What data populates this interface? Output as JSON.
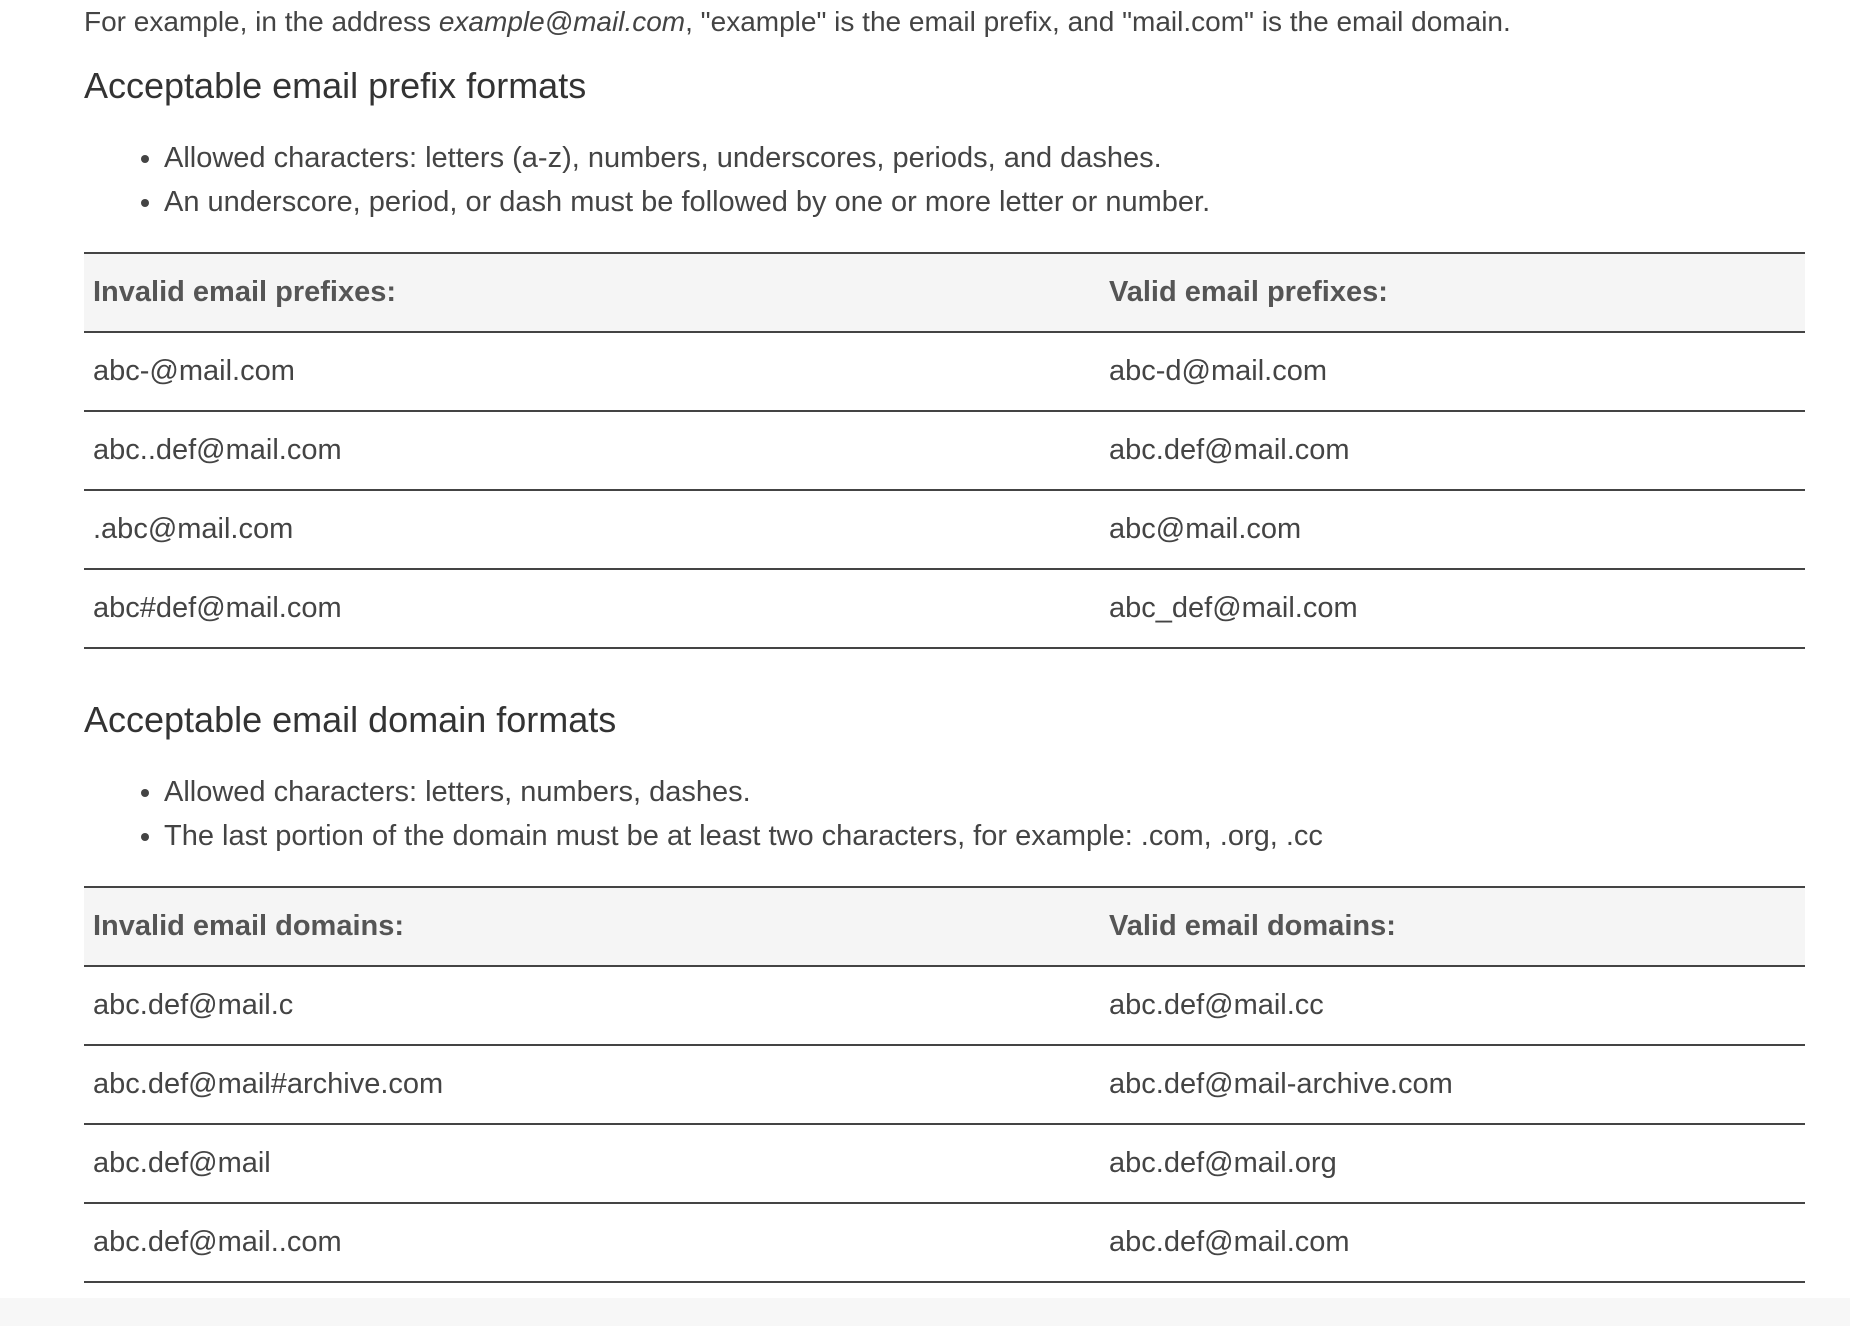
{
  "intro": {
    "prefix_text": "For example, in the address ",
    "example_address": "example@mail.com",
    "rest_text": ", \"example\" is the email prefix, and \"mail.com\" is the email domain."
  },
  "prefix_section": {
    "heading": "Acceptable email prefix formats",
    "rules": [
      "Allowed characters: letters (a-z), numbers, underscores, periods, and dashes.",
      "An underscore, period, or dash must be followed by one or more letter or number."
    ],
    "table": {
      "headers": [
        "Invalid email prefixes:",
        "Valid email prefixes:"
      ],
      "rows": [
        [
          "abc-@mail.com",
          "abc-d@mail.com"
        ],
        [
          "abc..def@mail.com",
          "abc.def@mail.com"
        ],
        [
          ".abc@mail.com",
          "abc@mail.com"
        ],
        [
          "abc#def@mail.com",
          "abc_def@mail.com"
        ]
      ]
    }
  },
  "domain_section": {
    "heading": "Acceptable email domain formats",
    "rules": [
      "Allowed characters: letters, numbers, dashes.",
      "The last portion of the domain must be at least two characters, for example: .com, .org, .cc"
    ],
    "table": {
      "headers": [
        "Invalid email domains:",
        "Valid email domains:"
      ],
      "rows": [
        [
          "abc.def@mail.c",
          "abc.def@mail.cc"
        ],
        [
          "abc.def@mail#archive.com",
          "abc.def@mail-archive.com"
        ],
        [
          "abc.def@mail",
          "abc.def@mail.org"
        ],
        [
          "abc.def@mail..com",
          "abc.def@mail.com"
        ]
      ]
    }
  }
}
